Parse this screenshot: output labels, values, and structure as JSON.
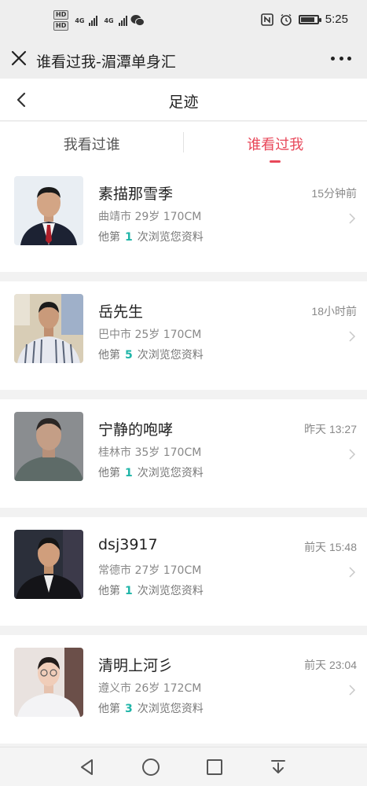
{
  "status_bar": {
    "hd_badges": [
      "HD",
      "HD"
    ],
    "network_1": "4G",
    "network_2": "4G",
    "time": "5:25",
    "battery_level": 0.85,
    "icons": [
      "nfc-icon",
      "alarm-icon",
      "battery-icon",
      "wechat-status-icon"
    ]
  },
  "title_bar": {
    "title": "谁看过我-湄潭单身汇"
  },
  "page_header": {
    "title": "足迹"
  },
  "tabs": [
    {
      "label": "我看过谁",
      "active": false
    },
    {
      "label": "谁看过我",
      "active": true
    }
  ],
  "visitors": [
    {
      "name": "素描那雪季",
      "time": "15分钟前",
      "city": "曲靖市",
      "age": "29岁",
      "height": "170CM",
      "visits_prefix": "他第",
      "count": "1",
      "visits_suffix": "次浏览您资料"
    },
    {
      "name": "岳先生",
      "time": "18小时前",
      "city": "巴中市",
      "age": "25岁",
      "height": "170CM",
      "visits_prefix": "他第",
      "count": "5",
      "visits_suffix": "次浏览您资料"
    },
    {
      "name": "宁静的咆哮",
      "time": "昨天 13:27",
      "city": "桂林市",
      "age": "35岁",
      "height": "170CM",
      "visits_prefix": "他第",
      "count": "1",
      "visits_suffix": "次浏览您资料"
    },
    {
      "name": "dsj3917",
      "time": "前天 15:48",
      "city": "常德市",
      "age": "27岁",
      "height": "170CM",
      "visits_prefix": "他第",
      "count": "1",
      "visits_suffix": "次浏览您资料"
    },
    {
      "name": "清明上河彡",
      "time": "前天 23:04",
      "city": "遵义市",
      "age": "26岁",
      "height": "172CM",
      "visits_prefix": "他第",
      "count": "3",
      "visits_suffix": "次浏览您资料"
    }
  ],
  "nav_bar": {
    "icons": [
      "back-triangle-icon",
      "home-circle-icon",
      "recents-square-icon",
      "notification-pull-icon"
    ]
  },
  "colors": {
    "accent": "#e8485a",
    "count": "#1fb5a8",
    "background": "#f2f2f2"
  }
}
